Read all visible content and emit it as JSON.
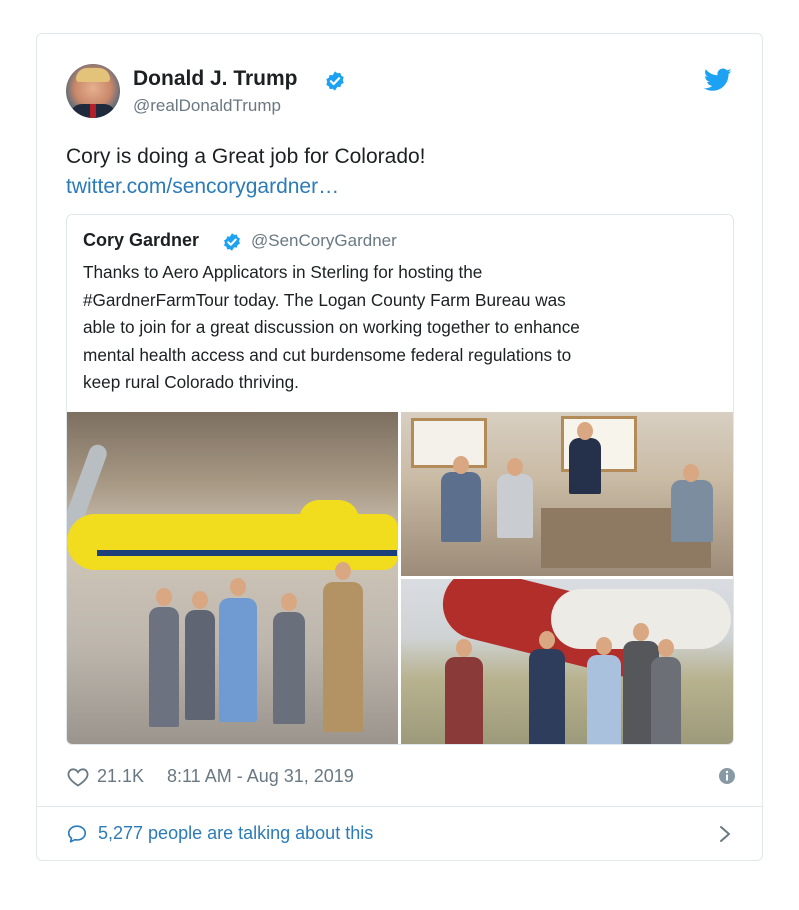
{
  "tweet": {
    "author_name": "Donald J. Trump",
    "author_handle": "@realDonaldTrump",
    "text": "Cory is doing a Great job for Colorado!",
    "link": "twitter.com/sencorygardner…",
    "likes": "21.1K",
    "timestamp": "8:11 AM - Aug 31, 2019",
    "talking": "5,277 people are talking about this"
  },
  "quote": {
    "author_name": "Cory Gardner",
    "author_handle": "@SenCoryGardner",
    "lines": [
      "Thanks to Aero Applicators in Sterling for hosting the",
      "#GardnerFarmTour today. The Logan County Farm Bureau was",
      "able to join for a great discussion on working together to enhance",
      "mental health access and cut burdensome federal regulations to",
      "keep rural Colorado thriving."
    ]
  },
  "icons": {
    "avatar": "avatar",
    "verified": "verified-badge-icon",
    "bird": "twitter-bird-icon",
    "heart": "heart-icon",
    "info": "info-icon",
    "bubble": "speech-bubble-icon",
    "chevron": "chevron-right-icon"
  },
  "colors": {
    "brand_blue": "#1da1f2",
    "link_blue": "#2b7bb9",
    "muted": "#697882",
    "text": "#1c2022",
    "border": "#e1e8ed"
  }
}
